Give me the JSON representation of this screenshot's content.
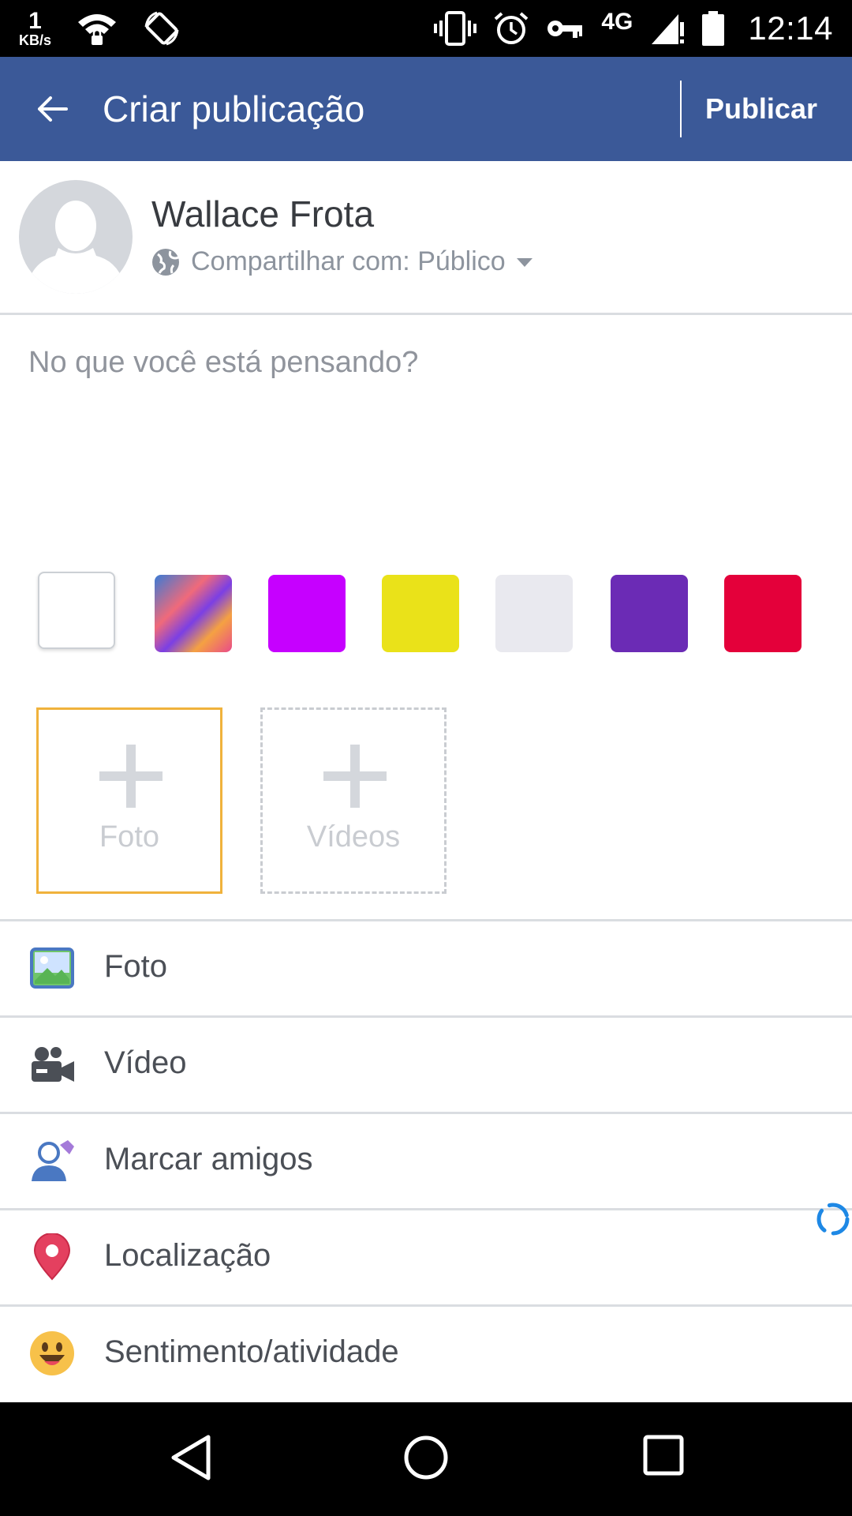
{
  "status_bar": {
    "speed_value": "1",
    "speed_unit": "KB/s",
    "network": "4G",
    "time": "12:14"
  },
  "app_bar": {
    "title": "Criar publicação",
    "publish_label": "Publicar",
    "color": "#3b5998"
  },
  "profile": {
    "name": "Wallace Frota",
    "privacy_label": "Compartilhar com: Público"
  },
  "composer": {
    "placeholder": "No que você está pensando?"
  },
  "swatches": [
    {
      "name": "white",
      "color": "#ffffff"
    },
    {
      "name": "colorful-bubbles",
      "color": "#f06a7a"
    },
    {
      "name": "magenta",
      "color": "#c600ff"
    },
    {
      "name": "yellow-pattern",
      "color": "#eae219"
    },
    {
      "name": "light-gray-pattern",
      "color": "#e9e9ef"
    },
    {
      "name": "purple-pattern",
      "color": "#6b2bb5"
    },
    {
      "name": "red",
      "color": "#e4003a"
    }
  ],
  "media": {
    "photo_label": "Foto",
    "video_label": "Vídeos"
  },
  "options": [
    {
      "icon": "photo-icon",
      "label": "Foto"
    },
    {
      "icon": "video-camera-icon",
      "label": "Vídeo"
    },
    {
      "icon": "tag-friends-icon",
      "label": "Marcar amigos"
    },
    {
      "icon": "location-pin-icon",
      "label": "Localização"
    },
    {
      "icon": "smiley-icon",
      "label": "Sentimento/atividade"
    }
  ]
}
